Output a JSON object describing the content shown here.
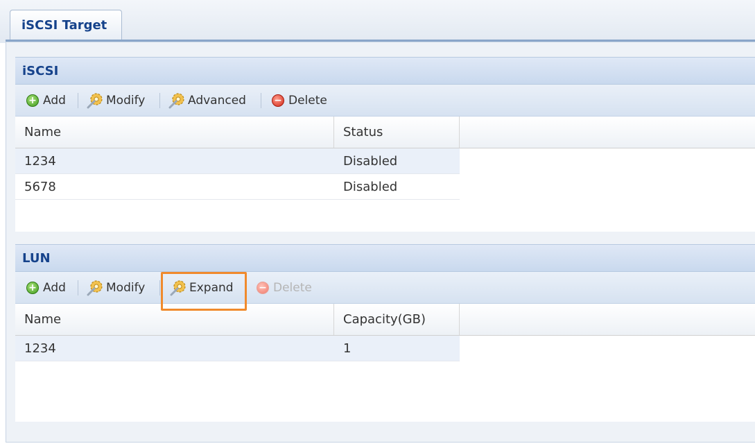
{
  "tab": {
    "label": "iSCSI Target"
  },
  "iscsi": {
    "title": "iSCSI",
    "toolbar": {
      "add": "Add",
      "modify": "Modify",
      "advanced": "Advanced",
      "delete": "Delete"
    },
    "columns": {
      "name": "Name",
      "status": "Status"
    },
    "rows": [
      {
        "name": "1234",
        "status": "Disabled"
      },
      {
        "name": "5678",
        "status": "Disabled"
      }
    ]
  },
  "lun": {
    "title": "LUN",
    "toolbar": {
      "add": "Add",
      "modify": "Modify",
      "expand": "Expand",
      "delete": "Delete"
    },
    "columns": {
      "name": "Name",
      "capacity": "Capacity(GB)"
    },
    "rows": [
      {
        "name": "1234",
        "capacity": "1"
      }
    ]
  },
  "colors": {
    "highlight": "#f08a2c",
    "header_text": "#15428b"
  }
}
